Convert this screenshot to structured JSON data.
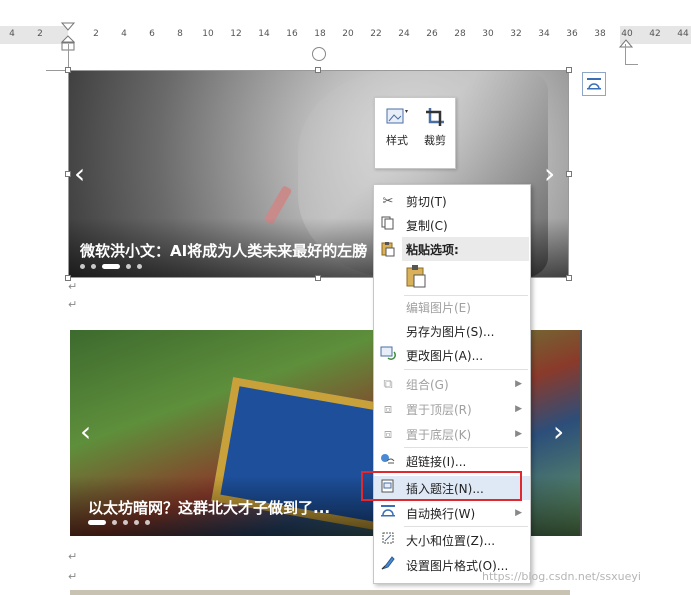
{
  "ruler": {
    "labels": [
      "4",
      "2",
      "2",
      "4",
      "6",
      "8",
      "10",
      "12",
      "14",
      "16",
      "18",
      "20",
      "22",
      "24",
      "26",
      "28",
      "30",
      "32",
      "34",
      "36",
      "38",
      "40",
      "42",
      "44"
    ]
  },
  "carousel1": {
    "caption": "微软洪小文：AI将成为人类未来最好的左膀",
    "prev": "‹",
    "next": "›"
  },
  "carousel2": {
    "caption": "以太坊暗网？这群北大才子做到了...",
    "prev": "‹",
    "next": "›"
  },
  "paragraph_mark": "↵",
  "mini_toolbar": {
    "style_label": "样式",
    "crop_label": "裁剪"
  },
  "context_menu": {
    "cut": "剪切(T)",
    "copy": "复制(C)",
    "paste_options": "粘贴选项:",
    "edit_picture": "编辑图片(E)",
    "save_as_picture": "另存为图片(S)...",
    "change_picture": "更改图片(A)...",
    "group": "组合(G)",
    "bring_to_front": "置于顶层(R)",
    "send_to_back": "置于底层(K)",
    "hyperlink": "超链接(I)...",
    "insert_caption": "插入题注(N)...",
    "wrap_text": "自动换行(W)",
    "size_position": "大小和位置(Z)...",
    "format_picture": "设置图片格式(O)..."
  },
  "watermark": "https://blog.csdn.net/ssxueyi",
  "colors": {
    "highlight_box": "#e0282e",
    "menu_hover": "#dfe9f6"
  }
}
